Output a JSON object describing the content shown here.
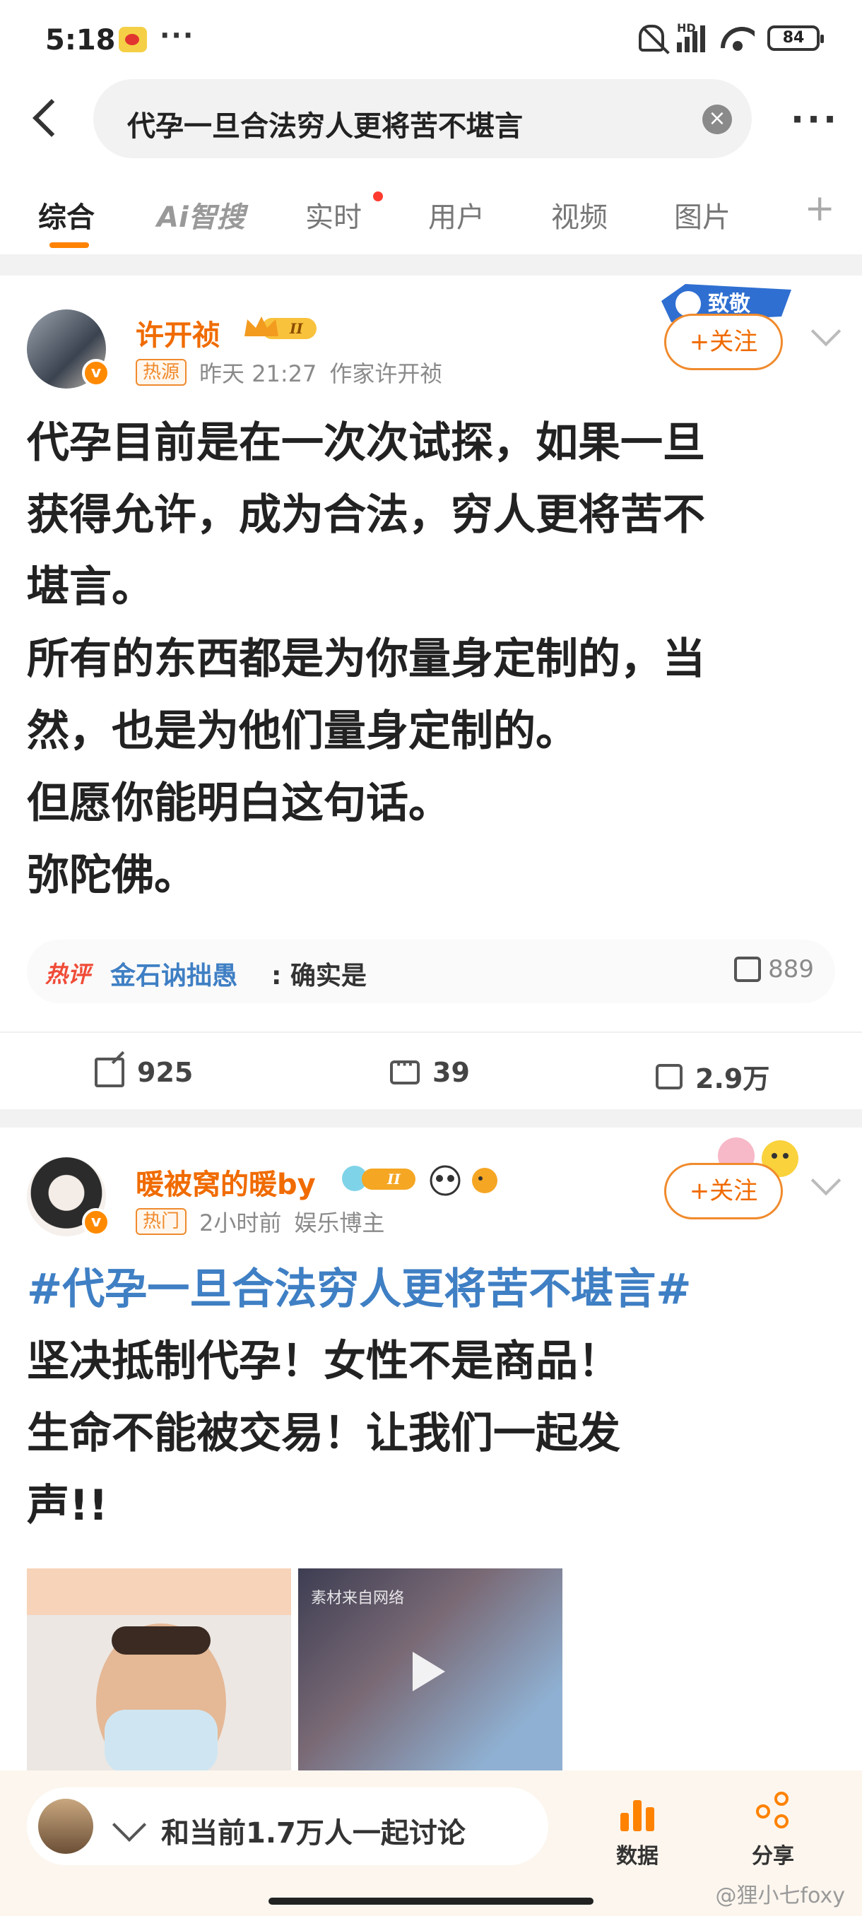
{
  "status_bar": {
    "time": "5:18",
    "dots": "···",
    "battery": "84",
    "hd": "HD"
  },
  "header": {
    "search_query": "代孕一旦合法穷人更将苦不堪言",
    "clear": "×",
    "more": "···"
  },
  "tabs": [
    {
      "label": "综合"
    },
    {
      "label": "Ai智搜"
    },
    {
      "label": "实时"
    },
    {
      "label": "用户"
    },
    {
      "label": "视频"
    },
    {
      "label": "图片"
    }
  ],
  "tab_add": "+",
  "posts": [
    {
      "username": "许开祯",
      "level": "II",
      "tag": "热源",
      "time": "昨天 21:27",
      "source": "作家许开祯",
      "follow_label": "+关注",
      "decoration_text": "致敬",
      "text": "代孕目前是在一次次试探，如果一旦\n获得允许，成为合法，穷人更将苦不\n堪言。\n所有的东西都是为你量身定制的，当\n然，也是为他们量身定制的。\n但愿你能明白这句话。\n弥陀佛。",
      "hot_comment": {
        "tag": "热评",
        "user": "金石讷拙愚",
        "text": ": 确实是",
        "likes": "889"
      },
      "reposts": "925",
      "comments": "39",
      "likes": "2.9万"
    },
    {
      "username": "暖被窝的暖by",
      "level": "II",
      "tag": "热门",
      "time": "2小时前",
      "source": "娱乐博主",
      "follow_label": "+关注",
      "hashtag": "#代孕一旦合法穷人更将苦不堪言#",
      "text": "坚决抵制代孕！女性不是商品！\n生命不能被交易！让我们一起发\n声!!",
      "thumb_label": "素材来自网络"
    }
  ],
  "bottom_bar": {
    "discuss_text": "和当前1.7万人一起讨论",
    "data_label": "数据",
    "share_label": "分享"
  },
  "watermark": "@狸小七foxy",
  "colors": {
    "accent": "#ff8200",
    "username": "#f06b00",
    "link": "#3f7fc4",
    "hot": "#f04b37"
  }
}
